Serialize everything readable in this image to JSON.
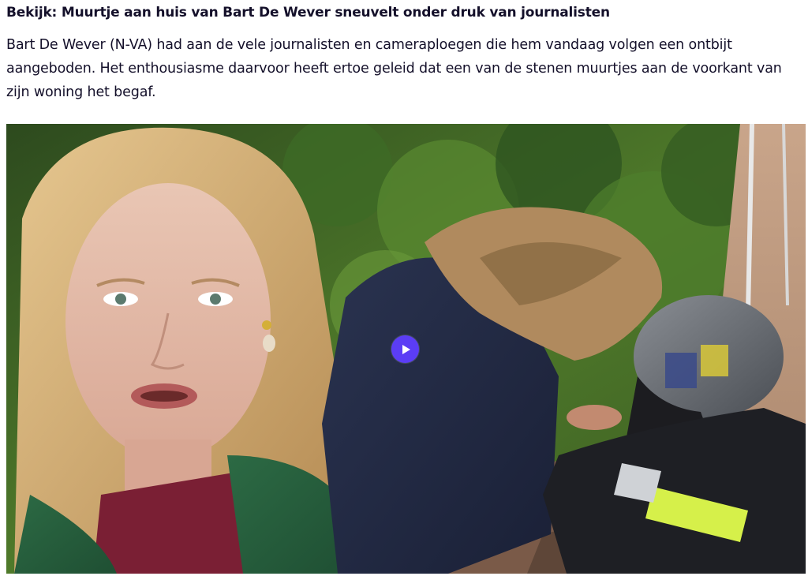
{
  "article": {
    "headline": "Bekijk: Muurtje aan huis van Bart De Wever sneuvelt onder druk van journalisten",
    "lead": "Bart De Wever (N-VA) had aan de vele journalisten en cameraploegen die hem vandaag volgen een ontbijt aangeboden. Het enthousiasme daarvoor heeft ertoe geleid dat een van de stenen muurtjes aan de voorkant van zijn woning het begaf."
  },
  "video": {
    "thumbnail_description_icon": "video-thumbnail",
    "play_icon": "play-icon"
  },
  "colors": {
    "text": "#14102a",
    "play_button": "#5b3df5",
    "play_glyph": "#ffffff",
    "background": "#ffffff"
  }
}
